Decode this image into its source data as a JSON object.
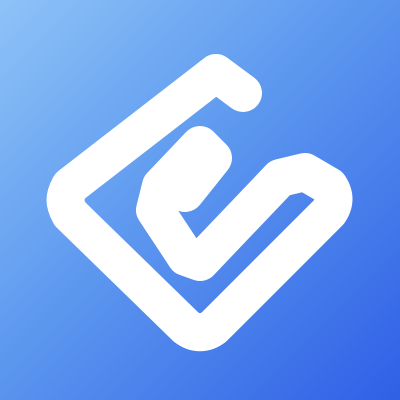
{
  "icon": {
    "name": "app-logo-icon",
    "colors": {
      "gradient_start": "#8ec3f7",
      "gradient_mid": "#5d98ef",
      "gradient_end": "#2f5fe6",
      "glyph": "#ffffff"
    }
  }
}
